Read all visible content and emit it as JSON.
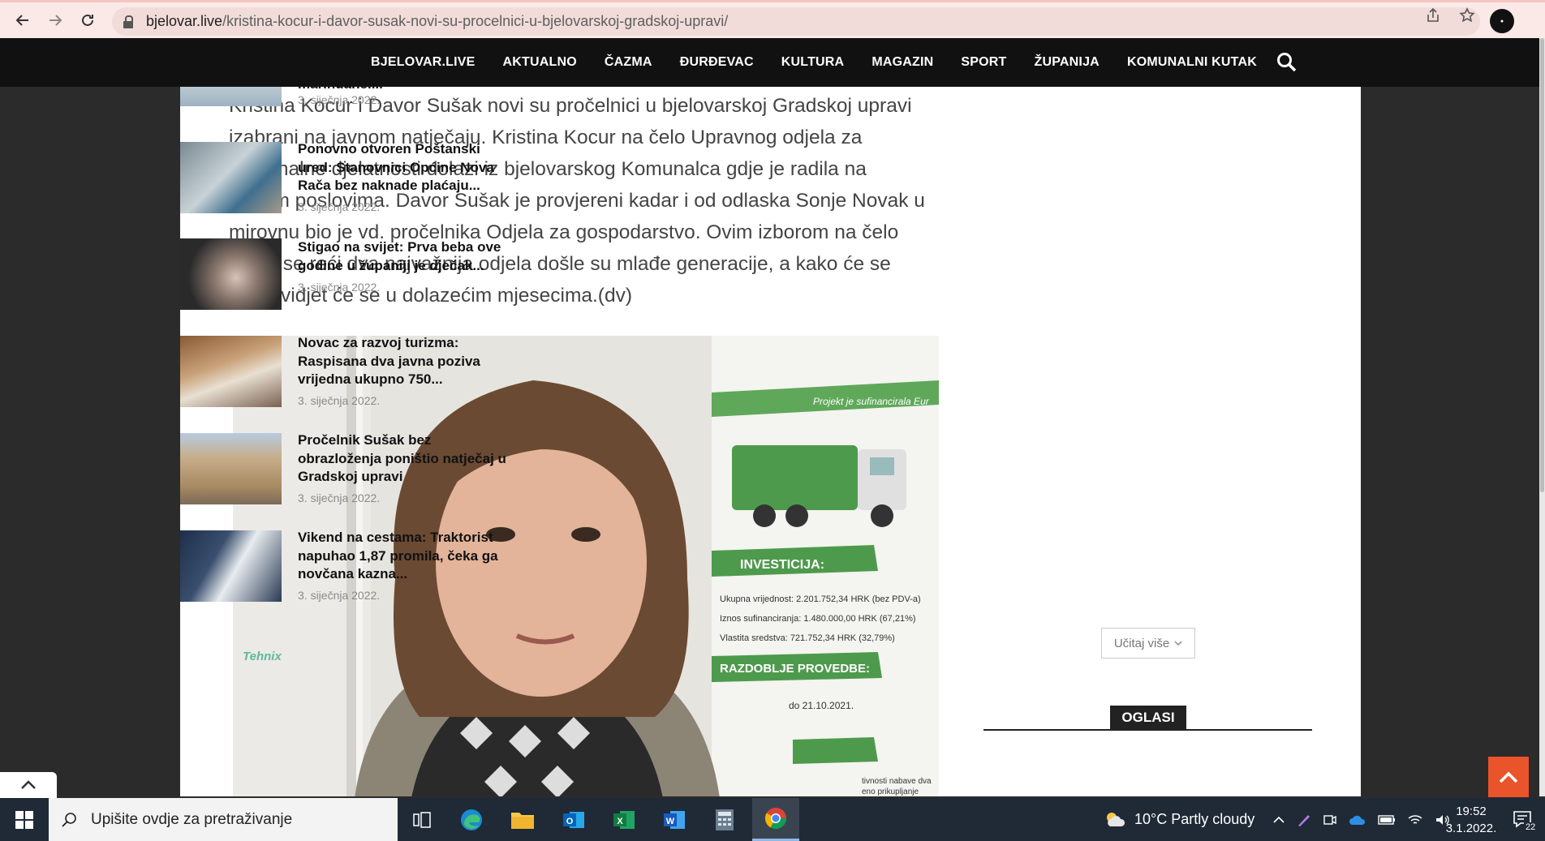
{
  "browser": {
    "url_domain": "bjelovar.live",
    "url_path": "/kristina-kocur-i-davor-susak-novi-su-procelnici-u-bjelovarskoj-gradskoj-upravi/",
    "back_icon": "arrow-left-icon",
    "forward_icon": "arrow-right-icon",
    "reload_icon": "reload-icon"
  },
  "nav": {
    "items": [
      {
        "label": "BJELOVAR.LIVE"
      },
      {
        "label": "AKTUALNO"
      },
      {
        "label": "ČAZMA"
      },
      {
        "label": "ĐURĐEVAC"
      },
      {
        "label": "KULTURA"
      },
      {
        "label": "MAGAZIN"
      },
      {
        "label": "SPORT"
      },
      {
        "label": "ŽUPANIJA"
      },
      {
        "label": "KOMUNALNI KUTAK"
      }
    ]
  },
  "article": {
    "text": "Kristina Kocur i Davor Sušak novi su pročelnici u bjelovarskoj Gradskoj upravi izabrani na javnom natječaju. Kristina Kocur na čelo Upravnog odjela za komunalne djelatnosti dolazi iz bjelovarskog Komunalca gdje je radila na sličnim poslovima. Davor Sušak je provjereni kadar i od odlaska Sonje Novak u mirovnu bio je vd. pročelnika Odjela za gospodarstvo. Ovim izborom na čelo može se reći dva najvažnija odjela došle su mlađe generacije, a kako će se snaći vidjet će se u dolazećim mjesecima.(dv)",
    "poster": {
      "header": "Projekt je sufinancirala Eur",
      "investicija": "INVESTICIJA:",
      "ukupna": "Ukupna vrijednost: 2.201.752,34 HRK (bez PDV-a)",
      "iznos": "Iznos sufinanciranja: 1.480.000,00 HRK (67,21%)",
      "vlastita": "Vlastita sredstva: 721.752,34 HRK (32,79%)",
      "razdoblje": "RAZDOBLJE PROVEDBE:",
      "do": "do 21.10.2021.",
      "brand": "Tehnix",
      "nabave": "tivnosti nabave dva",
      "prikupljanje": "eno prikupljanje"
    }
  },
  "sidebar": {
    "items": [
      {
        "title": "marihuane....",
        "date": "3. siječnja 2022."
      },
      {
        "title": "Ponovno otvoren Poštanski ured: Stanovnici Općine Nova Rača bez naknade plaćaju...",
        "date": "3. siječnja 2022."
      },
      {
        "title": "Stigao na svijet: Prva beba ove godine u županiji je dječak...",
        "date": "3. siječnja 2022."
      },
      {
        "title": "Novac za razvoj turizma: Raspisana dva javna poziva vrijedna ukupno 750...",
        "date": "3. siječnja 2022."
      },
      {
        "title": "Pročelnik Sušak bez obrazloženja poništio natječaj u Gradskoj upravi",
        "date": "3. siječnja 2022."
      },
      {
        "title": "Vikend na cestama: Traktorist napuhao 1,87 promila, čeka ga novčana kazna...",
        "date": "3. siječnja 2022."
      }
    ],
    "load_more": "Učitaj više",
    "ads_heading": "OGLASI"
  },
  "taskbar": {
    "search_placeholder": "Upišite ovdje za pretraživanje",
    "weather": "10°C  Partly cloudy",
    "time": "19:52",
    "date": "3.1.2022.",
    "notif_count": "22"
  }
}
